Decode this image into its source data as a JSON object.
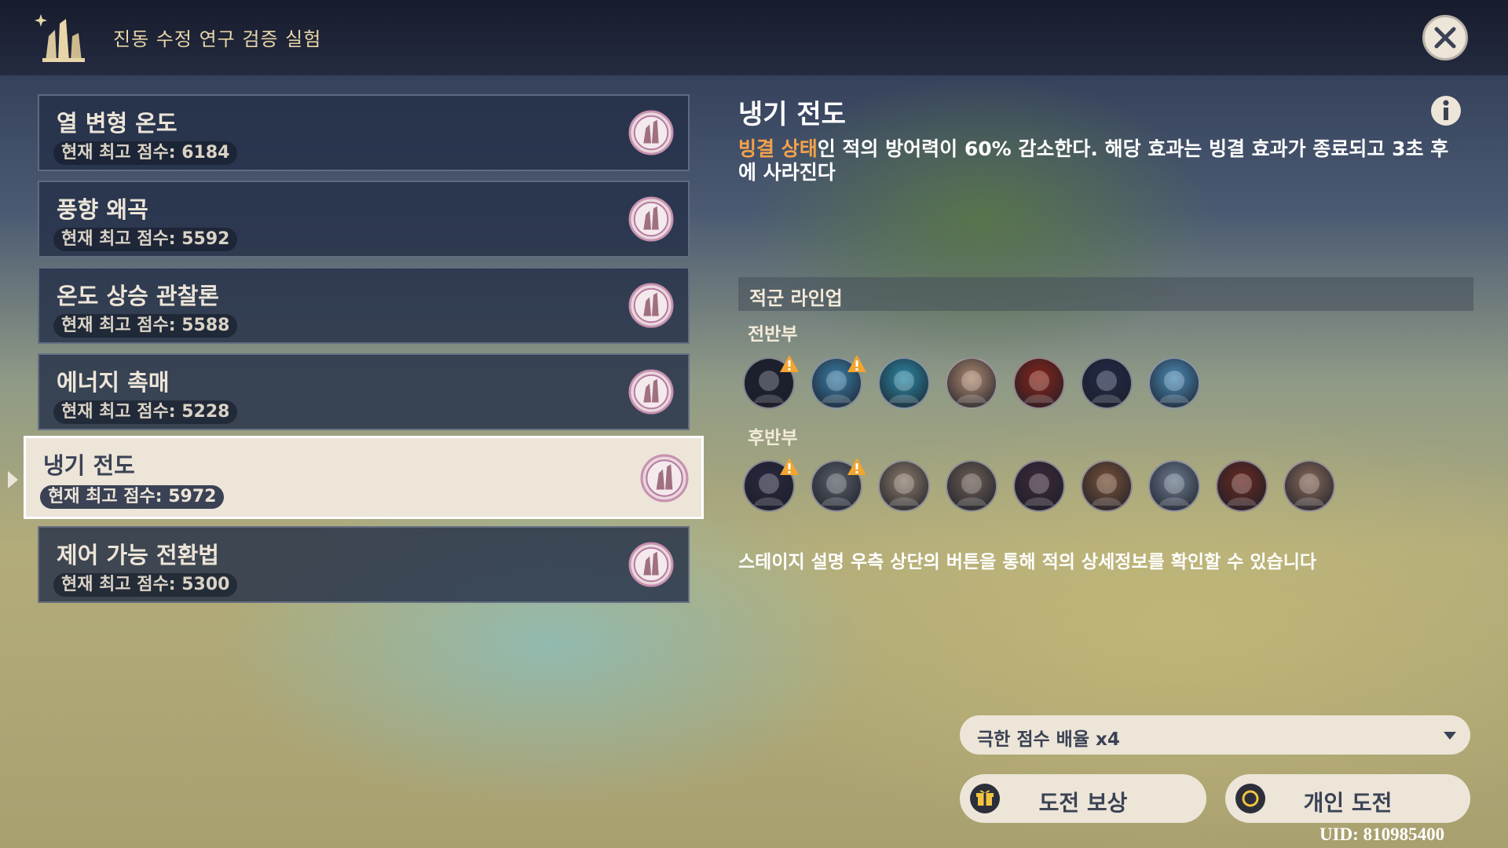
{
  "header": {
    "title": "진동 수정 연구 검증 실험"
  },
  "list": {
    "items": [
      {
        "name": "열 변형 온도",
        "score": "현재 최고 점수: 6184"
      },
      {
        "name": "풍향 왜곡",
        "score": "현재 최고 점수: 5592"
      },
      {
        "name": "온도 상승 관찰론",
        "score": "현재 최고 점수: 5588"
      },
      {
        "name": "에너지 촉매",
        "score": "현재 최고 점수: 5228"
      },
      {
        "name": "냉기 전도",
        "score": "현재 최고 점수: 5972"
      },
      {
        "name": "제어 가능 전환법",
        "score": "현재 최고 점수: 5300"
      }
    ],
    "selected_index": 4
  },
  "detail": {
    "title": "냉기 전도",
    "desc_highlight": "빙결 상태",
    "desc_rest": "인 적의 방어력이 60% 감소한다. 해당 효과는 빙결 효과가 종료되고 3초 후에 사라진다",
    "lineup_title": "적군 라인업",
    "first_half_label": "전반부",
    "second_half_label": "후반부",
    "first_half": [
      {
        "icon": "dark-mask-enemy-icon",
        "warn": true,
        "color": "#1d2130"
      },
      {
        "icon": "cryo-orb-enemy-icon",
        "warn": true,
        "color": "#3a7fa8"
      },
      {
        "icon": "cryo-slime-enemy-icon",
        "warn": false,
        "color": "#2c8aa6"
      },
      {
        "icon": "horned-beast-enemy-icon",
        "warn": false,
        "color": "#b08a70"
      },
      {
        "icon": "pyro-demon-enemy-icon",
        "warn": false,
        "color": "#8a2418"
      },
      {
        "icon": "armored-beast-enemy-icon",
        "warn": false,
        "color": "#222a48"
      },
      {
        "icon": "cryo-orb-enemy-icon",
        "warn": false,
        "color": "#4b8cb8"
      }
    ],
    "second_half": [
      {
        "icon": "dark-knight-enemy-icon",
        "warn": true,
        "color": "#2a2840"
      },
      {
        "icon": "helmeted-soldier-enemy-icon",
        "warn": true,
        "color": "#5a5f68"
      },
      {
        "icon": "masked-man-enemy-icon",
        "warn": false,
        "color": "#8d7c6a"
      },
      {
        "icon": "masked-man-enemy-icon",
        "warn": false,
        "color": "#6f5f55"
      },
      {
        "icon": "masked-rogue-enemy-icon",
        "warn": false,
        "color": "#3e2a3a"
      },
      {
        "icon": "soldier-enemy-icon",
        "warn": false,
        "color": "#7a5238"
      },
      {
        "icon": "silver-hair-enemy-icon",
        "warn": false,
        "color": "#6d7c90"
      },
      {
        "icon": "headband-warrior-enemy-icon",
        "warn": false,
        "color": "#6a2a22"
      },
      {
        "icon": "eyepatch-elder-enemy-icon",
        "warn": false,
        "color": "#8a6a5a"
      }
    ],
    "hint": "스테이지 설명 우측 상단의 버튼을 통해 적의 상세정보를 확인할 수 있습니다"
  },
  "controls": {
    "multiplier": "극한 점수 배율 x4",
    "reward_button": "도전 보상",
    "solo_button": "개인 도전"
  },
  "uid": "UID: 810985400",
  "colors": {
    "accent": "#f2a24c",
    "panel": "#ece5d8",
    "dark_text": "#3b4255"
  }
}
